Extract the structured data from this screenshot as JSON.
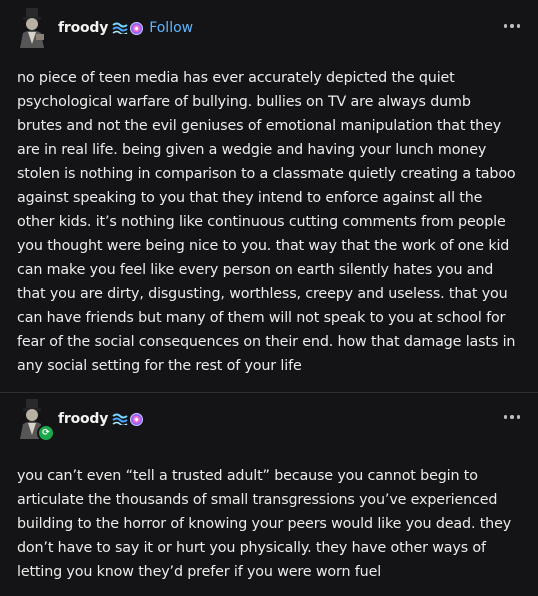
{
  "posts": [
    {
      "username": "froody",
      "follow_label": "Follow",
      "text": "no piece of teen media has ever accurately depicted the quiet psychological warfare of bullying. bullies on TV are always dumb brutes and not the evil geniuses of emotional manipulation that they are in real life. being given a wedgie and having your lunch money stolen is nothing in comparison to a classmate quietly creating a taboo against speaking to you that they intend to enforce against all the other kids. it’s nothing like continuous cutting comments from people you thought were being nice to you. that way that the work of one kid can make you feel like every person on earth silently hates you and that you are dirty, disgusting, worthless, creepy and useless. that you can have friends but many of them will not speak to you at school for fear of the social consequences on their end. how that damage lasts in any social setting for the rest of your life"
    },
    {
      "username": "froody",
      "text": "you can’t even “tell a trusted adult” because you cannot begin to articulate the thousands of small transgressions you’ve experienced building to the horror of knowing your peers would like you dead. they don’t have to say it or hurt you physically. they have other ways of letting you know they’d prefer if you were worn fuel"
    }
  ],
  "icons": {
    "avatar": "avatar-icon",
    "wave_badge": "wave-badge-icon",
    "circle_badge": "circle-badge-icon",
    "reblog": "reblog-icon",
    "more": "more-options-icon"
  },
  "colors": {
    "background": "#141416",
    "text": "#ececec",
    "follow": "#5eb6ff",
    "reblog_badge": "#1aa84a"
  }
}
